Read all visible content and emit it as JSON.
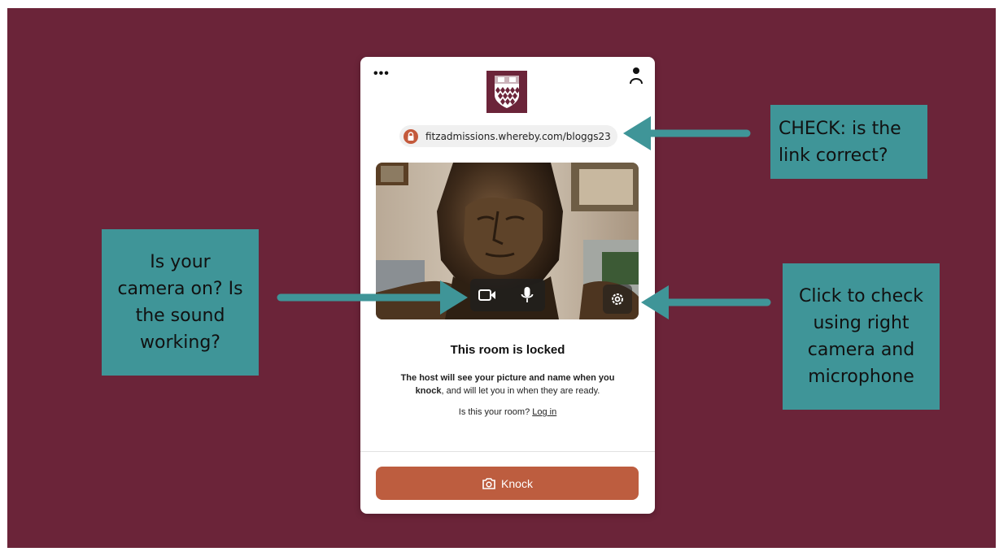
{
  "url": "fitzadmissions.whereby.com/bloggs23",
  "room": {
    "title": "This room is locked",
    "desc_bold1": "The host will see your picture and name when you",
    "desc_bold2": "knock",
    "desc_rest": ", and will let you in when they are ready.",
    "question": "Is this your room?",
    "login_link": "Log in"
  },
  "knock_label": "Knock",
  "menu_label": "•••",
  "callouts": {
    "link_check": "CHECK: is the\nlink correct?",
    "camera_check": "Is your\ncamera on? Is\nthe sound\nworking?",
    "settings_check": "Click to check\nusing right\ncamera and\nmicrophone"
  },
  "colors": {
    "background": "#6b2439",
    "callout": "#3f9598",
    "knock_button": "#bd5d3f",
    "lock_badge": "#c45a3c"
  },
  "icons": [
    "menu-dots-icon",
    "user-icon",
    "college-crest-logo",
    "lock-icon",
    "camera-icon",
    "microphone-icon",
    "settings-gear-icon",
    "knock-camera-icon",
    "arrow-left-icon"
  ]
}
